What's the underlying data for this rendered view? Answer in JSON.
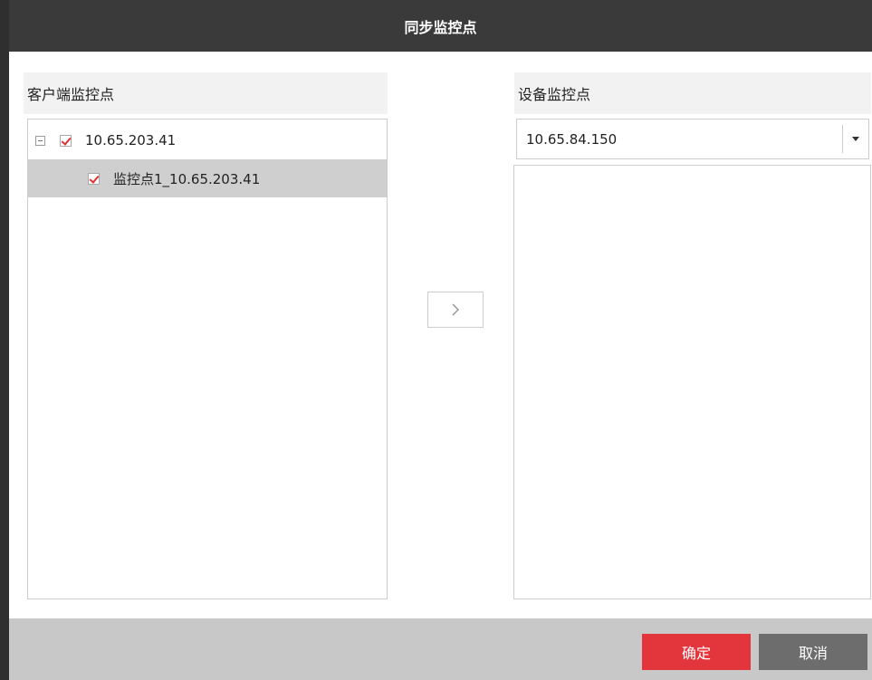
{
  "dialog": {
    "title": "同步监控点"
  },
  "left": {
    "header": "客户端监控点",
    "tree": [
      {
        "label": "10.65.203.41",
        "checked": true,
        "expanded": true
      },
      {
        "label": "监控点1_10.65.203.41",
        "checked": true,
        "selected": true
      }
    ]
  },
  "right": {
    "header": "设备监控点",
    "device_select": {
      "value": "10.65.84.150"
    }
  },
  "buttons": {
    "ok": "确定",
    "cancel": "取消"
  },
  "colors": {
    "title_bar": "#3a3a3a",
    "ok_button": "#e2363c",
    "cancel_button": "#6d6d6d",
    "check_mark": "#e03030",
    "selected_row": "#cfcfcf"
  },
  "icons": {
    "move_right": "chevron-right-icon",
    "dropdown": "caret-down-icon",
    "collapse": "tree-collapse-icon"
  }
}
